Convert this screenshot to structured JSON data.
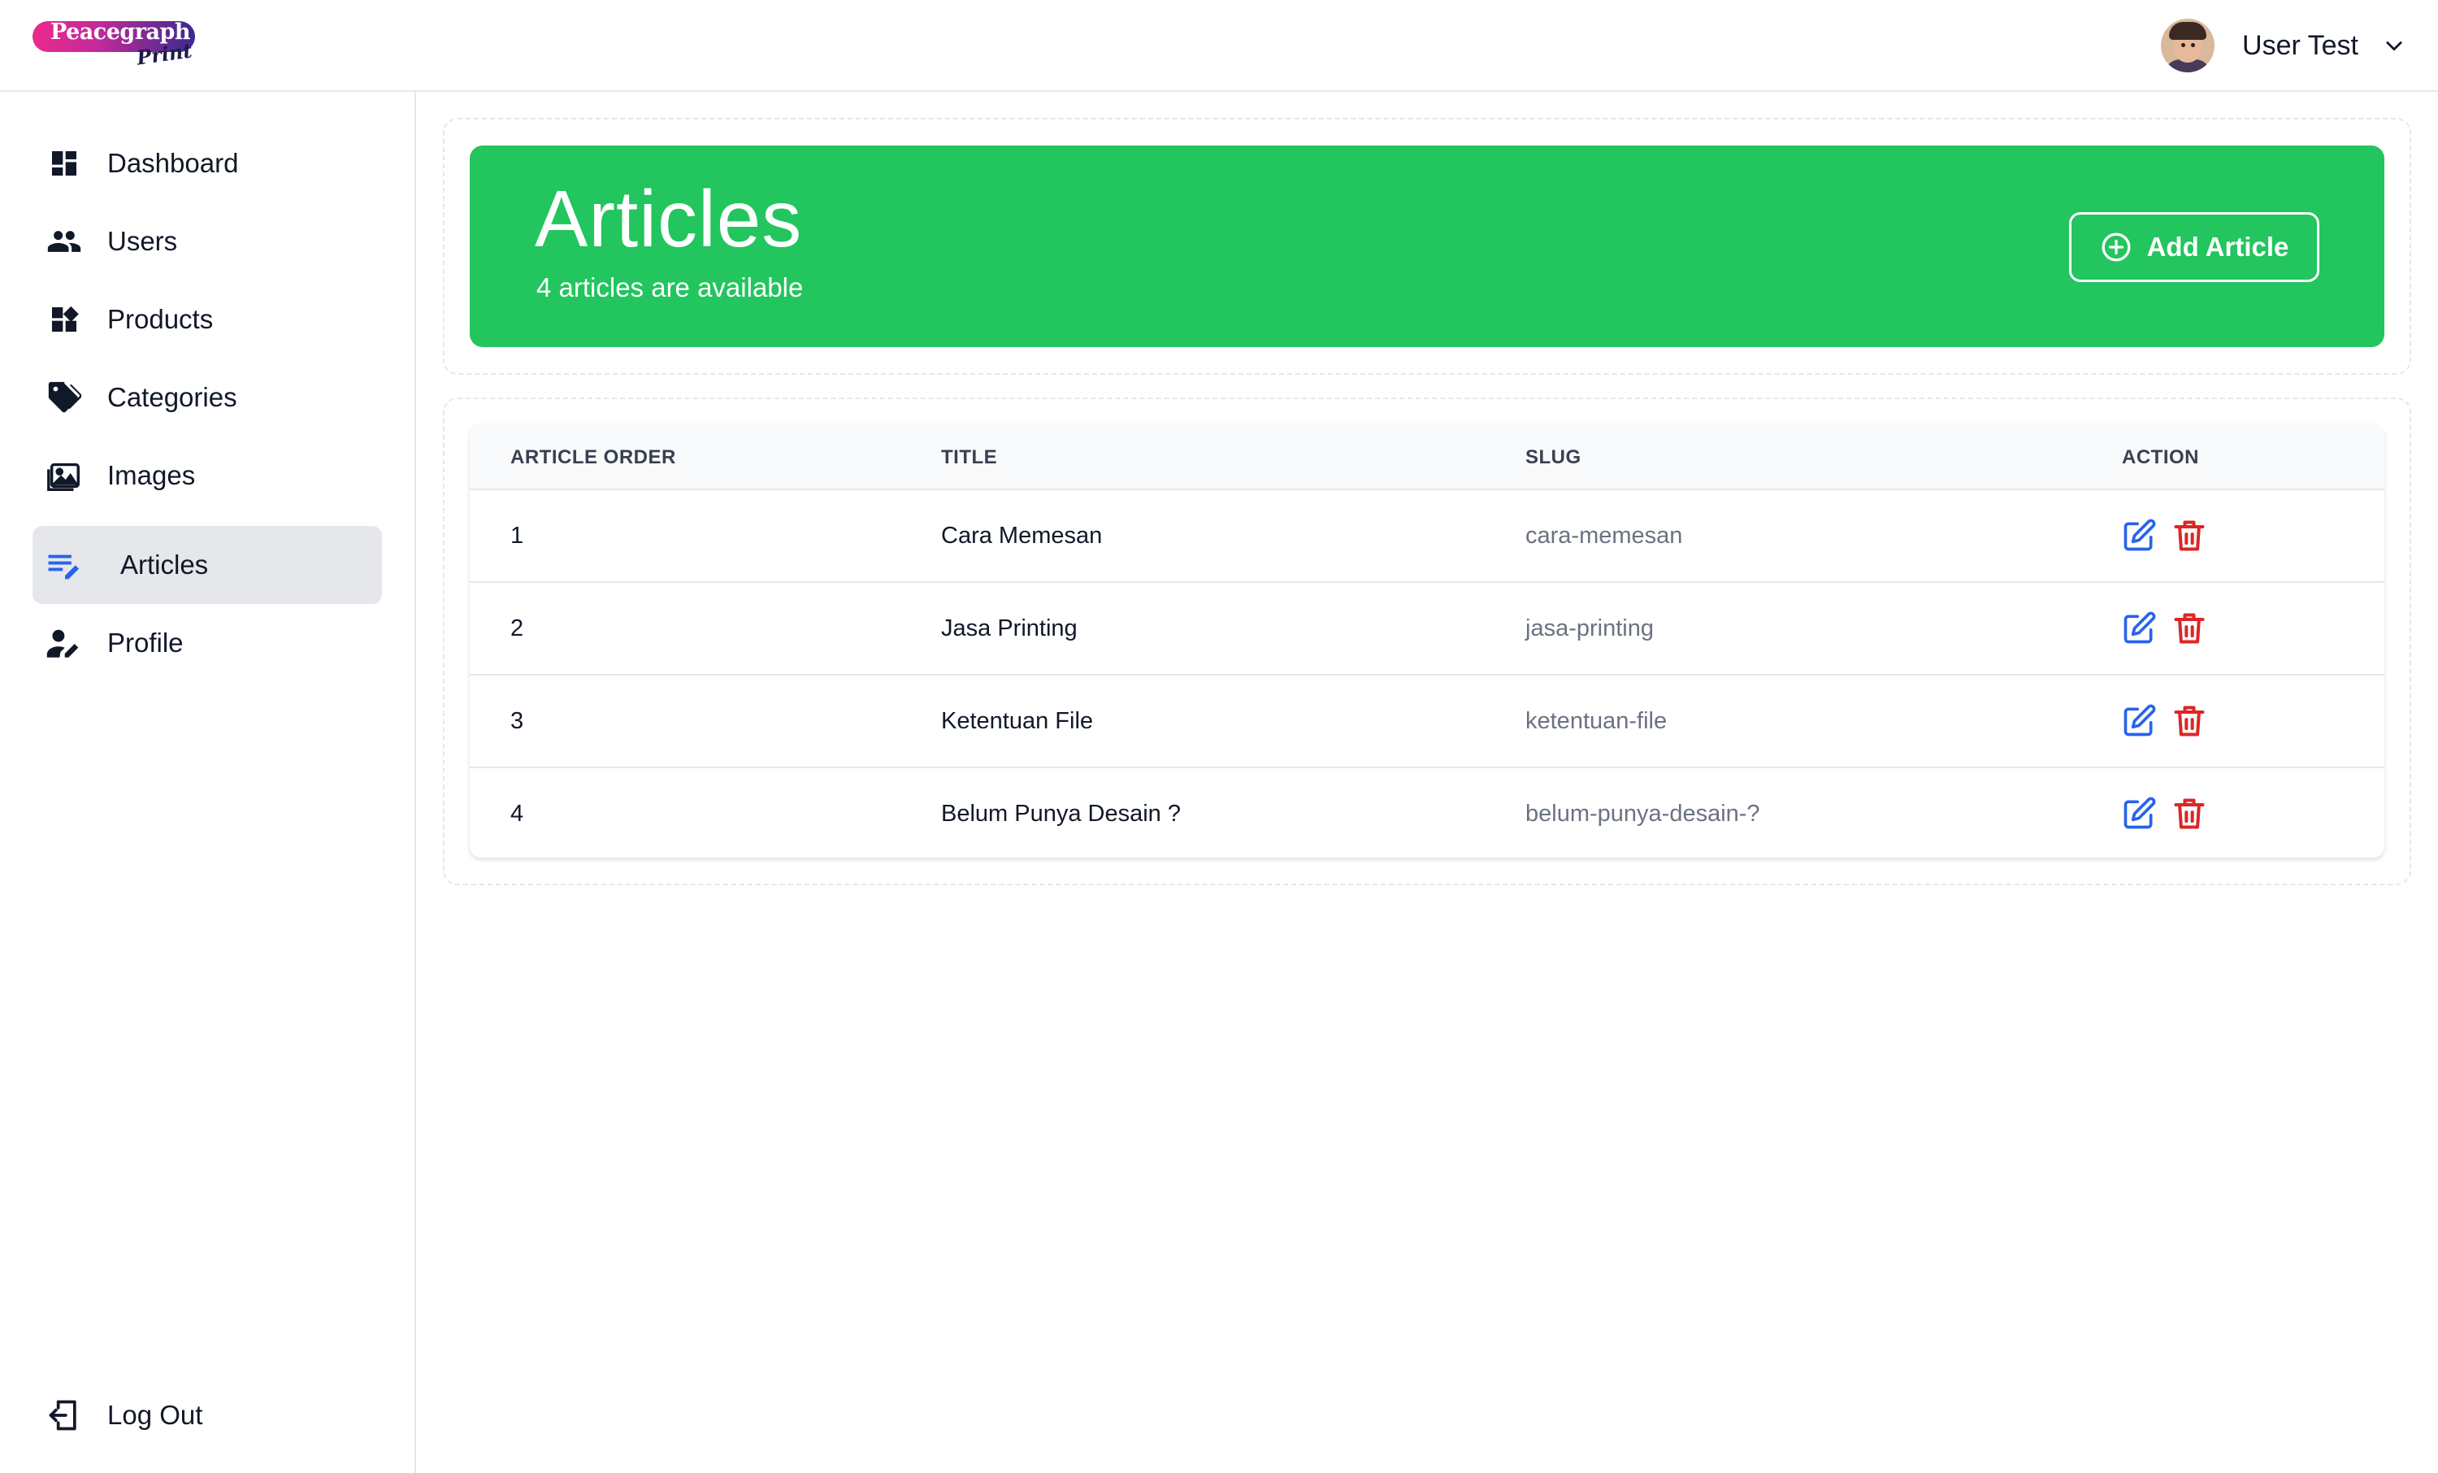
{
  "brand": {
    "logo_text": "Peacegraph",
    "logo_script": "Print"
  },
  "header": {
    "user_name": "User Test"
  },
  "sidebar": {
    "items": [
      {
        "label": "Dashboard",
        "icon": "dashboard-icon"
      },
      {
        "label": "Users",
        "icon": "users-icon"
      },
      {
        "label": "Products",
        "icon": "products-icon"
      },
      {
        "label": "Categories",
        "icon": "tags-icon"
      },
      {
        "label": "Images",
        "icon": "images-icon"
      },
      {
        "label": "Articles",
        "icon": "articles-icon",
        "active": true
      },
      {
        "label": "Profile",
        "icon": "profile-edit-icon"
      }
    ],
    "logout_label": "Log Out"
  },
  "banner": {
    "title": "Articles",
    "subtitle": "4 articles are available",
    "add_button_label": "Add Article"
  },
  "table": {
    "headers": [
      "ARTICLE ORDER",
      "TITLE",
      "SLUG",
      "ACTION"
    ],
    "rows": [
      {
        "order": "1",
        "title": "Cara Memesan",
        "slug": "cara-memesan"
      },
      {
        "order": "2",
        "title": "Jasa Printing",
        "slug": "jasa-printing"
      },
      {
        "order": "3",
        "title": "Ketentuan File",
        "slug": "ketentuan-file"
      },
      {
        "order": "4",
        "title": "Belum Punya Desain ?",
        "slug": "belum-punya-desain-?"
      }
    ]
  },
  "colors": {
    "accent_green": "#22c55e",
    "edit_blue": "#2563eb",
    "delete_red": "#dc2626",
    "active_nav_bg": "#e5e7eb"
  }
}
